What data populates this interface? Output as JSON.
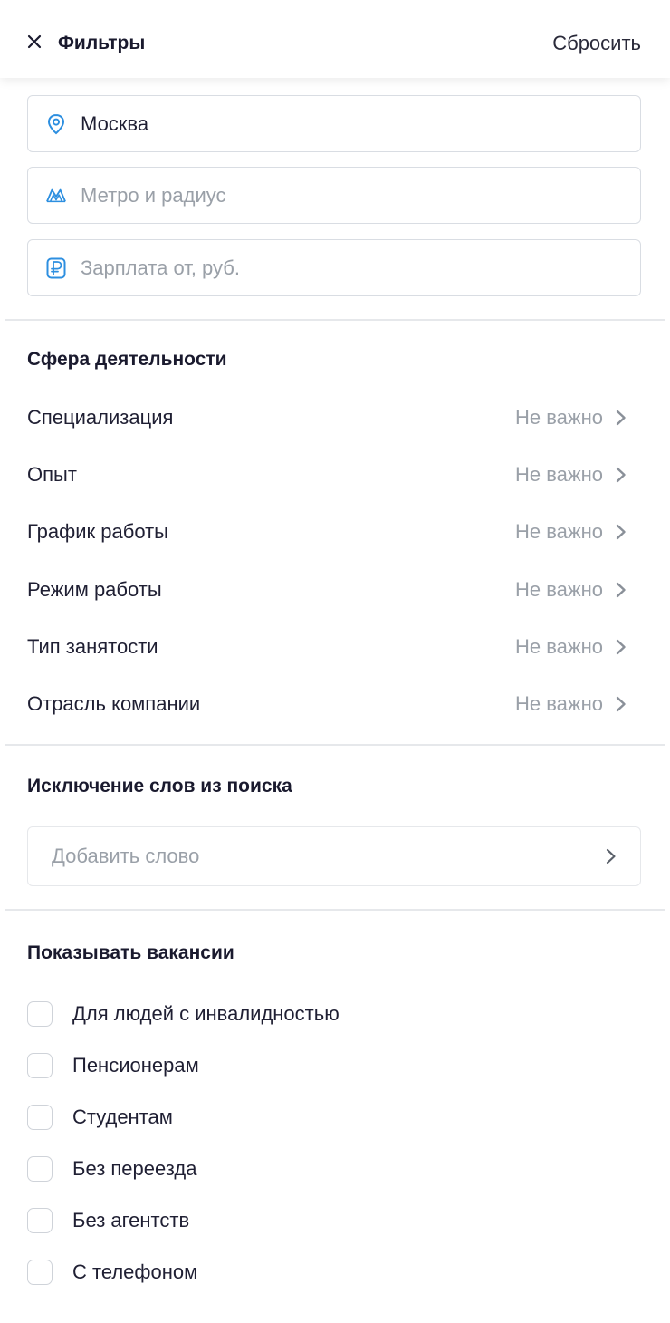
{
  "header": {
    "title": "Фильтры",
    "reset_label": "Сбросить"
  },
  "location": {
    "city_value": "Москва",
    "metro_placeholder": "Метро и радиус",
    "salary_placeholder": "Зарплата от, руб."
  },
  "activity": {
    "title": "Сфера деятельности",
    "rows": [
      {
        "label": "Специализация",
        "value": "Не важно"
      },
      {
        "label": "Опыт",
        "value": "Не важно"
      },
      {
        "label": "График работы",
        "value": "Не важно"
      },
      {
        "label": "Режим работы",
        "value": "Не важно"
      },
      {
        "label": "Тип занятости",
        "value": "Не важно"
      },
      {
        "label": "Отрасль компании",
        "value": "Не важно"
      }
    ]
  },
  "exclude_words": {
    "title": "Исключение слов из поиска",
    "add_placeholder": "Добавить слово"
  },
  "show_vacancies": {
    "title": "Показывать вакансии",
    "options": [
      {
        "label": "Для людей с инвалидностью",
        "checked": false
      },
      {
        "label": "Пенсионерам",
        "checked": false
      },
      {
        "label": "Студентам",
        "checked": false
      },
      {
        "label": "Без переезда",
        "checked": false
      },
      {
        "label": "Без агентств",
        "checked": false
      },
      {
        "label": "С телефоном",
        "checked": false
      }
    ]
  },
  "icons": {
    "close": "close-icon",
    "location": "location-pin-icon",
    "metro": "metro-icon",
    "salary": "ruble-icon",
    "chevron": "chevron-right-icon"
  },
  "colors": {
    "accent": "#2d8fe0",
    "text": "#1f1f33",
    "muted": "#9aa0a8",
    "border": "#d9dde3"
  }
}
